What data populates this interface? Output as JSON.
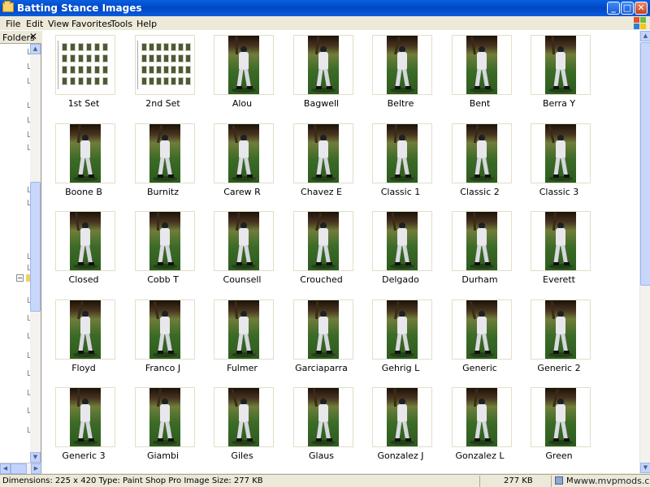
{
  "window": {
    "title": "Batting Stance Images",
    "buttons": {
      "minimize": "_",
      "maximize": "□",
      "close": "✕"
    }
  },
  "menu": [
    "File",
    "Edit",
    "View",
    "Favorites",
    "Tools",
    "Help"
  ],
  "folders_pane": {
    "label": "Folders",
    "close": "✕"
  },
  "items": [
    "1st Set",
    "2nd Set",
    "Alou",
    "Bagwell",
    "Beltre",
    "Bent",
    "Berra Y",
    "Boone B",
    "Burnitz",
    "Carew R",
    "Chavez E",
    "Classic 1",
    "Classic 2",
    "Classic 3",
    "Closed",
    "Cobb T",
    "Counsell",
    "Crouched",
    "Delgado",
    "Durham",
    "Everett",
    "Floyd",
    "Franco J",
    "Fulmer",
    "Garciaparra",
    "Gehrig L",
    "Generic",
    "Generic 2",
    "Generic 3",
    "Giambi",
    "Giles",
    "Glaus",
    "Gonzalez J",
    "Gonzalez L",
    "Green"
  ],
  "status": {
    "details": "Dimensions: 225 x 420 Type: Paint Shop Pro Image Size: 277 KB",
    "size": "277 KB",
    "zone": "My",
    "watermark": "www.mvpmods.com"
  },
  "colors": {
    "titlebar": "#0A5FE0",
    "window_bg": "#ECE9D8",
    "view_bg": "#FFFFFF"
  },
  "icons": [
    "folder-icon",
    "windows-flag-icon",
    "close-icon",
    "computer-icon"
  ]
}
